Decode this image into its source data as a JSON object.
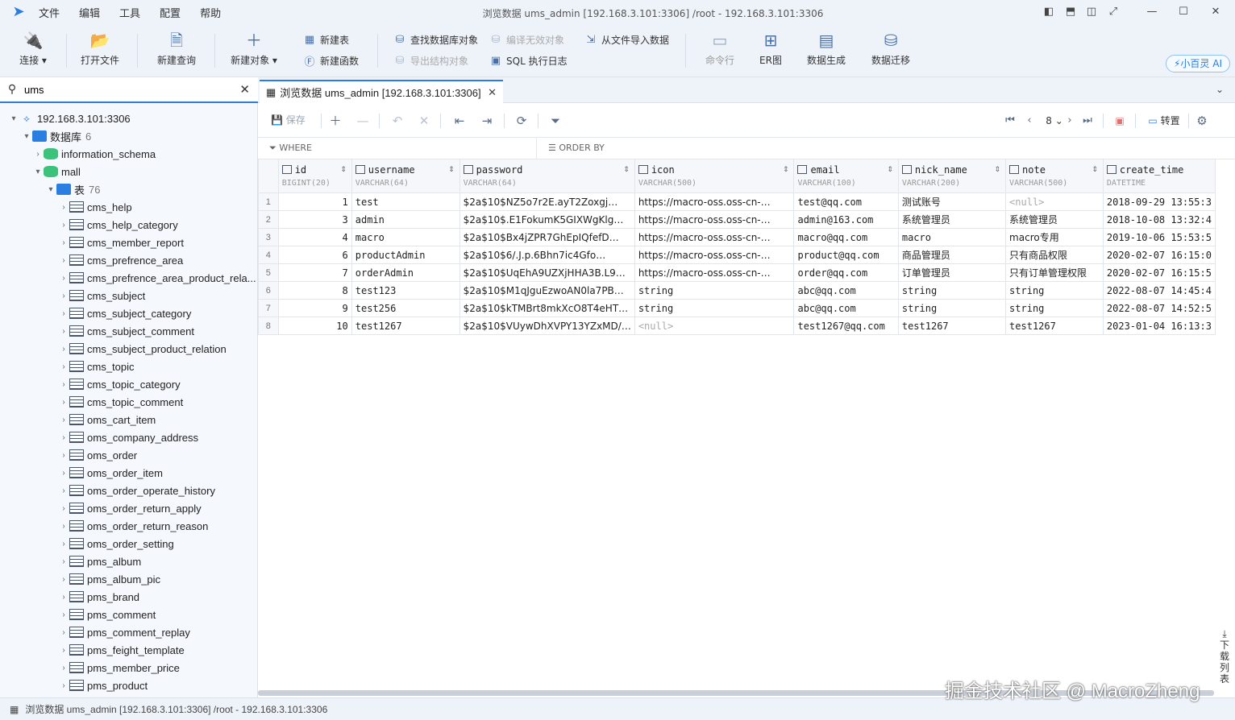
{
  "menu": [
    "文件",
    "编辑",
    "工具",
    "配置",
    "帮助"
  ],
  "window_title": "浏览数据 ums_admin [192.168.3.101:3306] /root  - 192.168.3.101:3306",
  "toolbar": {
    "connect": "连接",
    "open_file": "打开文件",
    "new_query": "新建查询",
    "new_object": "新建对象",
    "new_table": "新建表",
    "new_function": "新建函数",
    "find_db_object": "查找数据库对象",
    "compile_invalid": "编译无效对象",
    "export_structure": "导出结构对象",
    "sql_log": "SQL 执行日志",
    "import_file": "从文件导入数据",
    "command_line": "命令行",
    "er_diagram": "ER图",
    "data_gen": "数据生成",
    "data_migrate": "数据迁移",
    "ai": "小百灵 AI"
  },
  "sidebar": {
    "search_value": "ums",
    "connection": "192.168.3.101:3306",
    "db_folder": "数据库",
    "db_count": "6",
    "databases": [
      "information_schema",
      "mall"
    ],
    "table_folder": "表",
    "table_count": "76",
    "tables": [
      "cms_help",
      "cms_help_category",
      "cms_member_report",
      "cms_prefrence_area",
      "cms_prefrence_area_product_rela...",
      "cms_subject",
      "cms_subject_category",
      "cms_subject_comment",
      "cms_subject_product_relation",
      "cms_topic",
      "cms_topic_category",
      "cms_topic_comment",
      "oms_cart_item",
      "oms_company_address",
      "oms_order",
      "oms_order_item",
      "oms_order_operate_history",
      "oms_order_return_apply",
      "oms_order_return_reason",
      "oms_order_setting",
      "pms_album",
      "pms_album_pic",
      "pms_brand",
      "pms_comment",
      "pms_comment_replay",
      "pms_feight_template",
      "pms_member_price",
      "pms_product"
    ]
  },
  "tab": {
    "label": "浏览数据 ums_admin [192.168.3.101:3306]"
  },
  "grid_toolbar": {
    "save": "保存",
    "page": "8",
    "transpose": "转置"
  },
  "filter": {
    "where": "WHERE",
    "order_by": "ORDER BY"
  },
  "columns": [
    {
      "name": "id",
      "type": "BIGINT(20)"
    },
    {
      "name": "username",
      "type": "VARCHAR(64)"
    },
    {
      "name": "password",
      "type": "VARCHAR(64)"
    },
    {
      "name": "icon",
      "type": "VARCHAR(500)"
    },
    {
      "name": "email",
      "type": "VARCHAR(100)"
    },
    {
      "name": "nick_name",
      "type": "VARCHAR(200)"
    },
    {
      "name": "note",
      "type": "VARCHAR(500)"
    },
    {
      "name": "create_time",
      "type": "DATETIME"
    }
  ],
  "rows": [
    [
      "1",
      "test",
      "$2a$10$NZ5o7r2E.ayT2Zoxgj…",
      "https://macro-oss.oss-cn-…",
      "test@qq.com",
      "测试账号",
      "<null>",
      "2018-09-29 13:55:3"
    ],
    [
      "3",
      "admin",
      "$2a$10$.E1FokumK5GIXWgKlg…",
      "https://macro-oss.oss-cn-…",
      "admin@163.com",
      "系统管理员",
      "系统管理员",
      "2018-10-08 13:32:4"
    ],
    [
      "4",
      "macro",
      "$2a$10$Bx4jZPR7GhEpIQfefD…",
      "https://macro-oss.oss-cn-…",
      "macro@qq.com",
      "macro",
      "macro专用",
      "2019-10-06 15:53:5"
    ],
    [
      "6",
      "productAdmin",
      "$2a$10$6/.J.p.6Bhn7ic4Gfo…",
      "https://macro-oss.oss-cn-…",
      "product@qq.com",
      "商品管理员",
      "只有商品权限",
      "2020-02-07 16:15:0"
    ],
    [
      "7",
      "orderAdmin",
      "$2a$10$UqEhA9UZXjHHA3B.L9…",
      "https://macro-oss.oss-cn-…",
      "order@qq.com",
      "订单管理员",
      "只有订单管理权限",
      "2020-02-07 16:15:5"
    ],
    [
      "8",
      "test123",
      "$2a$10$M1qJguEzwoAN0la7PB…",
      "string",
      "abc@qq.com",
      "string",
      "string",
      "2022-08-07 14:45:4"
    ],
    [
      "9",
      "test256",
      "$2a$10$kTMBrt8mkXcO8T4eHT…",
      "string",
      "abc@qq.com",
      "string",
      "string",
      "2022-08-07 14:52:5"
    ],
    [
      "10",
      "test1267",
      "$2a$10$VUywDhXVPY13YZxMD/…",
      "<null>",
      "test1267@qq.com",
      "test1267",
      "test1267",
      "2023-01-04 16:13:3"
    ]
  ],
  "download_list": "下载列表",
  "status": "浏览数据 ums_admin [192.168.3.101:3306] /root - 192.168.3.101:3306",
  "watermark": "掘金技术社区 @ MacroZheng"
}
